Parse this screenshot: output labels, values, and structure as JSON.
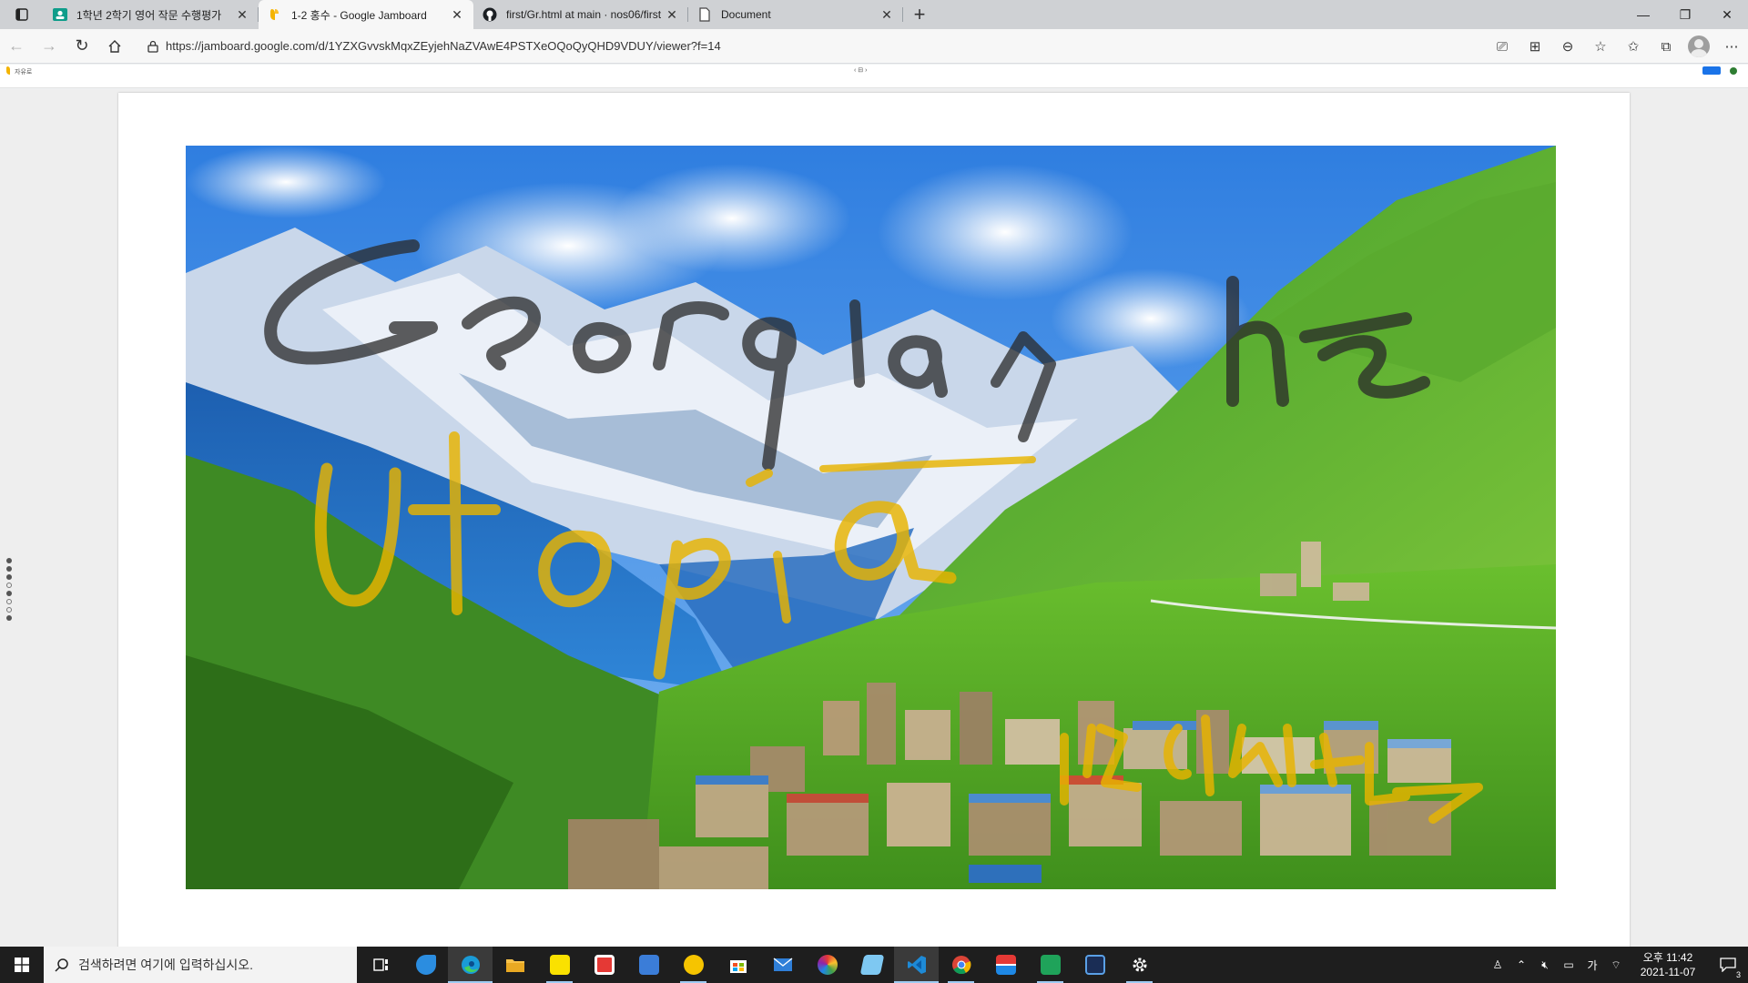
{
  "browser": {
    "tabs": [
      {
        "title": "1학년 2학기 영어 작문 수행평가",
        "favicon": "classroom-icon",
        "active": false
      },
      {
        "title": "1-2 홍수 - Google Jamboard",
        "favicon": "jamboard-icon",
        "active": true
      },
      {
        "title": "first/Gr.html at main · nos06/first",
        "favicon": "github-icon",
        "active": false
      },
      {
        "title": "Document",
        "favicon": "document-icon",
        "active": false
      }
    ],
    "url": "https://jamboard.google.com/d/1YZXGvvskMqxZEyjehNaZVAwE4PSTXeOQoQyQHD9VDUY/viewer?f=14",
    "new_tab": "+",
    "window": {
      "minimize": "—",
      "restore": "❐",
      "close": "✕"
    }
  },
  "jamboard": {
    "app_label": "자유로",
    "frame_nav": "‹  ⊟  ›",
    "annotations": {
      "line1": "Georgia, the",
      "line2": "Utopia",
      "author": "1211 이상현"
    },
    "colors": {
      "ink_black": "#222222",
      "ink_yellow": "#e8b400"
    }
  },
  "taskbar": {
    "search_placeholder": "검색하려면 여기에 입력하십시오.",
    "apps": [
      "task-view",
      "bird-app",
      "edge",
      "file-explorer",
      "kakaotalk",
      "sync-app",
      "calculator-app",
      "kakaopage",
      "microsoft-store",
      "mail",
      "paint-app",
      "whiteboard-app",
      "vscode",
      "chrome",
      "media-app",
      "green-app",
      "dj-app",
      "settings"
    ],
    "clock": {
      "time": "오후 11:42",
      "date": "2021-11-07"
    },
    "ime": "가",
    "notifications": "3"
  }
}
